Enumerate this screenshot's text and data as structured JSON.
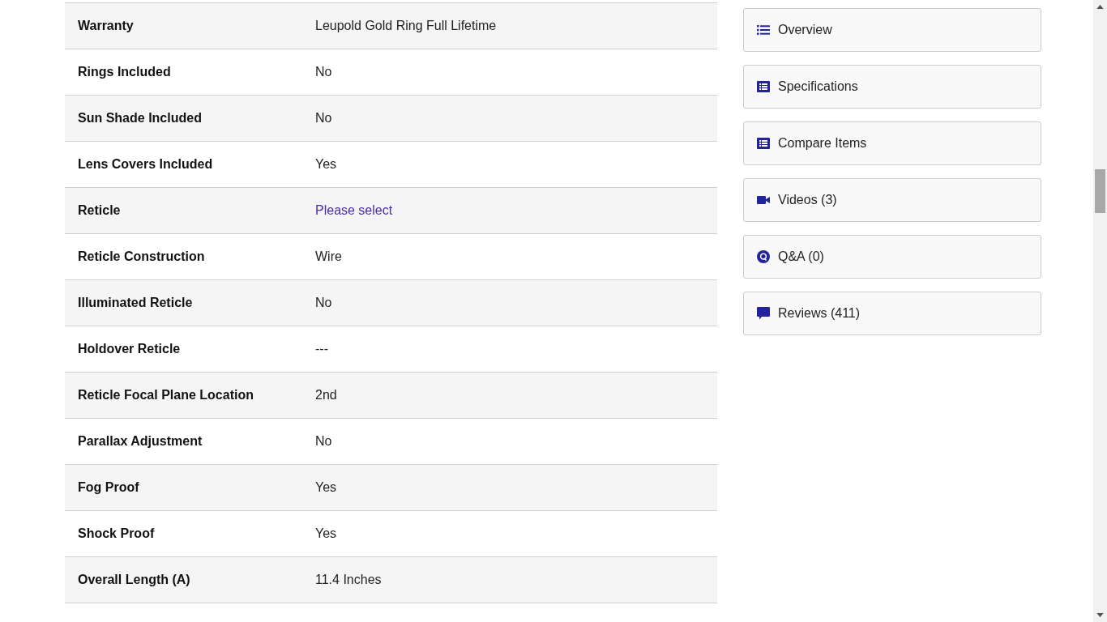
{
  "specs": [
    {
      "label": "Warranty",
      "value": "Leupold Gold Ring Full Lifetime",
      "kind": "text"
    },
    {
      "label": "Rings Included",
      "value": "No",
      "kind": "text"
    },
    {
      "label": "Sun Shade Included",
      "value": "No",
      "kind": "text"
    },
    {
      "label": "Lens Covers Included",
      "value": "Yes",
      "kind": "text"
    },
    {
      "label": "Reticle",
      "value": "Please select",
      "kind": "link"
    },
    {
      "label": "Reticle Construction",
      "value": "Wire",
      "kind": "text"
    },
    {
      "label": "Illuminated Reticle",
      "value": "No",
      "kind": "text"
    },
    {
      "label": "Holdover Reticle",
      "value": "---",
      "kind": "text"
    },
    {
      "label": "Reticle Focal Plane Location",
      "value": "2nd",
      "kind": "text"
    },
    {
      "label": "Parallax Adjustment",
      "value": "No",
      "kind": "text"
    },
    {
      "label": "Fog Proof",
      "value": "Yes",
      "kind": "text"
    },
    {
      "label": "Shock Proof",
      "value": "Yes",
      "kind": "text"
    },
    {
      "label": "Overall Length (A)",
      "value": "11.4 Inches",
      "kind": "text"
    }
  ],
  "sidebar": {
    "items": [
      {
        "label": "Overview"
      },
      {
        "label": "Specifications"
      },
      {
        "label": "Compare Items"
      },
      {
        "label": "Videos (3)"
      },
      {
        "label": "Q&A (0)"
      },
      {
        "label": "Reviews (411)"
      }
    ]
  }
}
